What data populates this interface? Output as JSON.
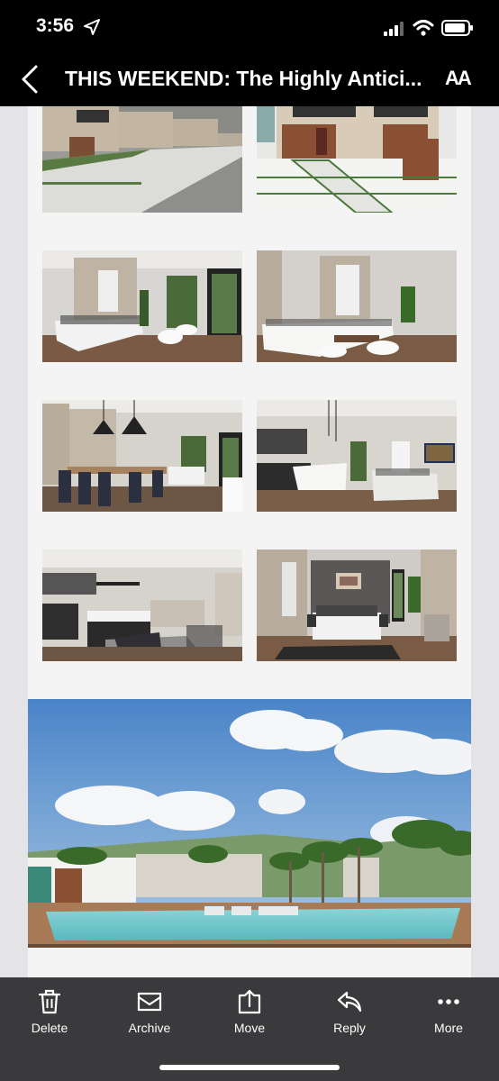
{
  "status_bar": {
    "time": "3:56",
    "icons": [
      "location-arrow-icon",
      "cellular-signal-icon",
      "wifi-icon",
      "battery-icon"
    ]
  },
  "header": {
    "back_icon": "chevron-left-icon",
    "title": "THIS WEEKEND:  The Highly Antici...",
    "text_size_label": "AA"
  },
  "gallery": {
    "images": [
      {
        "name": "townhouse-street-image"
      },
      {
        "name": "townhouse-front-image"
      },
      {
        "name": "living-room-image-1"
      },
      {
        "name": "living-room-image-2"
      },
      {
        "name": "dining-room-image"
      },
      {
        "name": "kitchen-living-image"
      },
      {
        "name": "kitchen-island-image"
      },
      {
        "name": "bedroom-image"
      }
    ],
    "hero_image": "pool-amenity-image"
  },
  "toolbar": {
    "items": [
      {
        "label": "Delete",
        "icon": "trash-icon"
      },
      {
        "label": "Archive",
        "icon": "archive-icon"
      },
      {
        "label": "Move",
        "icon": "move-icon"
      },
      {
        "label": "Reply",
        "icon": "reply-icon"
      },
      {
        "label": "More",
        "icon": "more-dots-icon"
      }
    ]
  },
  "colors": {
    "header_bg": "#000000",
    "content_bg": "#e4e4e6",
    "toolbar_bg": "#3a3a3c",
    "text": "#ffffff"
  }
}
